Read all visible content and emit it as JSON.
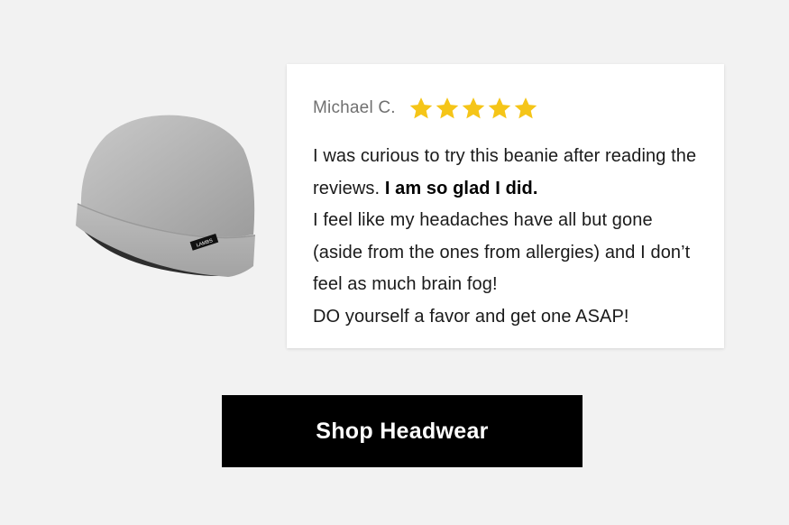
{
  "product": {
    "image_alt": "Gray beanie",
    "tag_text": "LAMBS"
  },
  "review": {
    "reviewer": "Michael C.",
    "rating": 5,
    "rating_max": 5,
    "star_color": "#f5c518",
    "line1": "I was curious to try this beanie after reading the reviews.",
    "line1_bold": "I am so glad I did.",
    "line2": "I feel like my headaches have all but gone (aside from the ones from allergies) and I don’t feel as much brain fog!",
    "line3": "DO yourself a favor and get one ASAP!"
  },
  "cta": {
    "label": "Shop Headwear"
  }
}
